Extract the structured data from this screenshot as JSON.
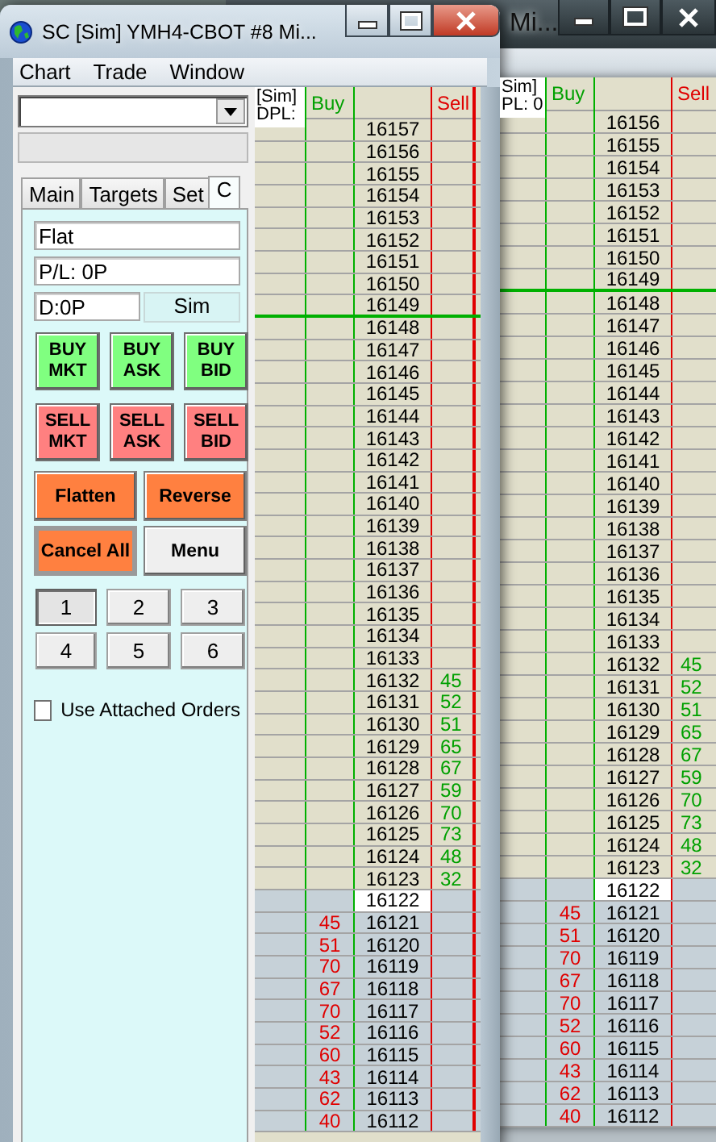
{
  "back_window": {
    "title": "Mi...",
    "ladder": {
      "info": [
        "Sim]",
        "PL: 0"
      ],
      "columns": [
        "Buy",
        "Sell"
      ],
      "rows": [
        {
          "price": "16156",
          "kind": "ask",
          "line": false
        },
        {
          "price": "16155",
          "kind": "ask",
          "line": false
        },
        {
          "price": "16154",
          "kind": "ask",
          "line": false
        },
        {
          "price": "16153",
          "kind": "ask",
          "line": false
        },
        {
          "price": "16152",
          "kind": "ask",
          "line": false
        },
        {
          "price": "16151",
          "kind": "ask",
          "line": false
        },
        {
          "price": "16150",
          "kind": "ask",
          "line": false
        },
        {
          "price": "16149",
          "kind": "ask",
          "line": true
        },
        {
          "price": "16148",
          "kind": "ask",
          "line": false
        },
        {
          "price": "16147",
          "kind": "ask",
          "line": false
        },
        {
          "price": "16146",
          "kind": "ask",
          "line": false
        },
        {
          "price": "16145",
          "kind": "ask",
          "line": false
        },
        {
          "price": "16144",
          "kind": "ask",
          "line": false
        },
        {
          "price": "16143",
          "kind": "ask",
          "line": false
        },
        {
          "price": "16142",
          "kind": "ask",
          "line": false
        },
        {
          "price": "16141",
          "kind": "ask",
          "line": false
        },
        {
          "price": "16140",
          "kind": "ask",
          "line": false
        },
        {
          "price": "16139",
          "kind": "ask",
          "line": false
        },
        {
          "price": "16138",
          "kind": "ask",
          "line": false
        },
        {
          "price": "16137",
          "kind": "ask",
          "line": false
        },
        {
          "price": "16136",
          "kind": "ask",
          "line": false
        },
        {
          "price": "16135",
          "kind": "ask",
          "line": false
        },
        {
          "price": "16134",
          "kind": "ask",
          "line": false
        },
        {
          "price": "16133",
          "kind": "ask",
          "line": false
        },
        {
          "price": "16132",
          "kind": "ask",
          "line": false,
          "sell": "45"
        },
        {
          "price": "16131",
          "kind": "ask",
          "line": false,
          "sell": "52"
        },
        {
          "price": "16130",
          "kind": "ask",
          "line": false,
          "sell": "51"
        },
        {
          "price": "16129",
          "kind": "ask",
          "line": false,
          "sell": "65"
        },
        {
          "price": "16128",
          "kind": "ask",
          "line": false,
          "sell": "67"
        },
        {
          "price": "16127",
          "kind": "ask",
          "line": false,
          "sell": "59"
        },
        {
          "price": "16126",
          "kind": "ask",
          "line": false,
          "sell": "70"
        },
        {
          "price": "16125",
          "kind": "ask",
          "line": false,
          "sell": "73"
        },
        {
          "price": "16124",
          "kind": "ask",
          "line": false,
          "sell": "48"
        },
        {
          "price": "16123",
          "kind": "ask",
          "line": false,
          "sell": "32"
        },
        {
          "price": "16122",
          "kind": "last",
          "line": false
        },
        {
          "price": "16121",
          "kind": "bid",
          "line": false,
          "buy": "45"
        },
        {
          "price": "16120",
          "kind": "bid",
          "line": false,
          "buy": "51"
        },
        {
          "price": "16119",
          "kind": "bid",
          "line": false,
          "buy": "70"
        },
        {
          "price": "16118",
          "kind": "bid",
          "line": false,
          "buy": "67"
        },
        {
          "price": "16117",
          "kind": "bid",
          "line": false,
          "buy": "70"
        },
        {
          "price": "16116",
          "kind": "bid",
          "line": false,
          "buy": "52"
        },
        {
          "price": "16115",
          "kind": "bid",
          "line": false,
          "buy": "60"
        },
        {
          "price": "16114",
          "kind": "bid",
          "line": false,
          "buy": "43"
        },
        {
          "price": "16113",
          "kind": "bid",
          "line": false,
          "buy": "62"
        },
        {
          "price": "16112",
          "kind": "bid",
          "line": false,
          "buy": "40"
        }
      ]
    }
  },
  "front_window": {
    "title": "SC [Sim] YMH4-CBOT  #8  Mi...",
    "menu": [
      "Chart",
      "Trade",
      "Window"
    ],
    "panel": {
      "tabs": [
        {
          "label": "Main",
          "selected": false
        },
        {
          "label": "Targets",
          "selected": false
        },
        {
          "label": "Set",
          "selected": false
        },
        {
          "label": "C",
          "selected": true
        }
      ],
      "position": "Flat",
      "profit_loss": "P/L: 0P",
      "daily": "D:0P",
      "mode": "Sim",
      "order_buttons": [
        {
          "label": "BUY",
          "sublabel": "MKT",
          "kind": "buy"
        },
        {
          "label": "BUY",
          "sublabel": "ASK",
          "kind": "buy"
        },
        {
          "label": "BUY",
          "sublabel": "BID",
          "kind": "buy"
        },
        {
          "label": "SELL",
          "sublabel": "MKT",
          "kind": "sell"
        },
        {
          "label": "SELL",
          "sublabel": "ASK",
          "kind": "sell"
        },
        {
          "label": "SELL",
          "sublabel": "BID",
          "kind": "sell"
        }
      ],
      "action_buttons": [
        {
          "label": "Flatten",
          "kind": "orange"
        },
        {
          "label": "Reverse",
          "kind": "orange"
        },
        {
          "label": "Cancel All",
          "kind": "framed"
        },
        {
          "label": "Menu",
          "kind": "plain"
        }
      ],
      "presets": [
        {
          "label": "1",
          "selected": true
        },
        {
          "label": "2",
          "selected": false
        },
        {
          "label": "3",
          "selected": false
        },
        {
          "label": "4",
          "selected": false
        },
        {
          "label": "5",
          "selected": false
        },
        {
          "label": "6",
          "selected": false
        }
      ],
      "attached_orders": {
        "label": "Use Attached Orders",
        "checked": false
      }
    },
    "ladder": {
      "info": [
        "[Sim]",
        "DPL:"
      ],
      "columns": [
        "Buy",
        "Sell"
      ],
      "rows": [
        {
          "price": "16157",
          "kind": "ask",
          "line": false
        },
        {
          "price": "16156",
          "kind": "ask",
          "line": false
        },
        {
          "price": "16155",
          "kind": "ask",
          "line": false
        },
        {
          "price": "16154",
          "kind": "ask",
          "line": false
        },
        {
          "price": "16153",
          "kind": "ask",
          "line": false
        },
        {
          "price": "16152",
          "kind": "ask",
          "line": false
        },
        {
          "price": "16151",
          "kind": "ask",
          "line": false
        },
        {
          "price": "16150",
          "kind": "ask",
          "line": false
        },
        {
          "price": "16149",
          "kind": "ask",
          "line": true
        },
        {
          "price": "16148",
          "kind": "ask",
          "line": false
        },
        {
          "price": "16147",
          "kind": "ask",
          "line": false
        },
        {
          "price": "16146",
          "kind": "ask",
          "line": false
        },
        {
          "price": "16145",
          "kind": "ask",
          "line": false
        },
        {
          "price": "16144",
          "kind": "ask",
          "line": false
        },
        {
          "price": "16143",
          "kind": "ask",
          "line": false
        },
        {
          "price": "16142",
          "kind": "ask",
          "line": false
        },
        {
          "price": "16141",
          "kind": "ask",
          "line": false
        },
        {
          "price": "16140",
          "kind": "ask",
          "line": false
        },
        {
          "price": "16139",
          "kind": "ask",
          "line": false
        },
        {
          "price": "16138",
          "kind": "ask",
          "line": false
        },
        {
          "price": "16137",
          "kind": "ask",
          "line": false
        },
        {
          "price": "16136",
          "kind": "ask",
          "line": false
        },
        {
          "price": "16135",
          "kind": "ask",
          "line": false
        },
        {
          "price": "16134",
          "kind": "ask",
          "line": false
        },
        {
          "price": "16133",
          "kind": "ask",
          "line": false
        },
        {
          "price": "16132",
          "kind": "ask",
          "line": false,
          "sell": "45"
        },
        {
          "price": "16131",
          "kind": "ask",
          "line": false,
          "sell": "52"
        },
        {
          "price": "16130",
          "kind": "ask",
          "line": false,
          "sell": "51"
        },
        {
          "price": "16129",
          "kind": "ask",
          "line": false,
          "sell": "65"
        },
        {
          "price": "16128",
          "kind": "ask",
          "line": false,
          "sell": "67"
        },
        {
          "price": "16127",
          "kind": "ask",
          "line": false,
          "sell": "59"
        },
        {
          "price": "16126",
          "kind": "ask",
          "line": false,
          "sell": "70"
        },
        {
          "price": "16125",
          "kind": "ask",
          "line": false,
          "sell": "73"
        },
        {
          "price": "16124",
          "kind": "ask",
          "line": false,
          "sell": "48"
        },
        {
          "price": "16123",
          "kind": "ask",
          "line": false,
          "sell": "32"
        },
        {
          "price": "16122",
          "kind": "last",
          "line": false
        },
        {
          "price": "16121",
          "kind": "bid",
          "line": false,
          "buy": "45"
        },
        {
          "price": "16120",
          "kind": "bid",
          "line": false,
          "buy": "51"
        },
        {
          "price": "16119",
          "kind": "bid",
          "line": false,
          "buy": "70"
        },
        {
          "price": "16118",
          "kind": "bid",
          "line": false,
          "buy": "67"
        },
        {
          "price": "16117",
          "kind": "bid",
          "line": false,
          "buy": "70"
        },
        {
          "price": "16116",
          "kind": "bid",
          "line": false,
          "buy": "52"
        },
        {
          "price": "16115",
          "kind": "bid",
          "line": false,
          "buy": "60"
        },
        {
          "price": "16114",
          "kind": "bid",
          "line": false,
          "buy": "43"
        },
        {
          "price": "16113",
          "kind": "bid",
          "line": false,
          "buy": "62"
        },
        {
          "price": "16112",
          "kind": "bid",
          "line": false,
          "buy": "40"
        }
      ]
    }
  }
}
